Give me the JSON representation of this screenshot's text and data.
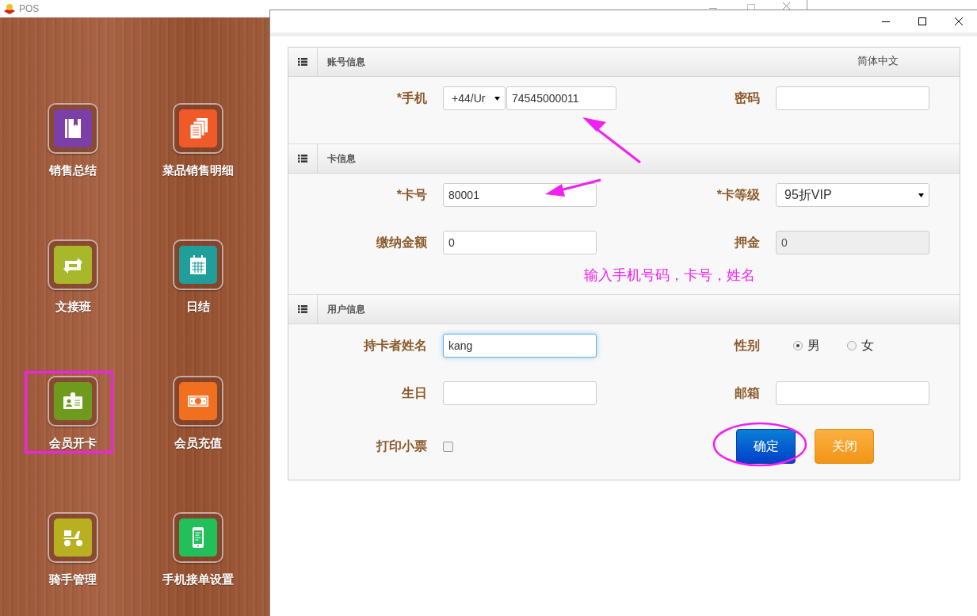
{
  "back_window": {
    "title": "POS"
  },
  "tiles": [
    {
      "label": "销售总结",
      "kind": "book",
      "color": "#7b3fa6",
      "highlighted": false
    },
    {
      "label": "菜品销售明细",
      "kind": "documents",
      "color": "#f05a28",
      "highlighted": false
    },
    {
      "label": "文接班",
      "kind": "swap",
      "color": "#a8b82a",
      "highlighted": false
    },
    {
      "label": "日结",
      "kind": "calendar",
      "color": "#1f9e9a",
      "highlighted": false
    },
    {
      "label": "会员开卡",
      "kind": "badge",
      "color": "#6e9a1e",
      "highlighted": true
    },
    {
      "label": "会员充值",
      "kind": "money",
      "color": "#f07020",
      "highlighted": false
    },
    {
      "label": "骑手管理",
      "kind": "scooter",
      "color": "#b8b020",
      "highlighted": false
    },
    {
      "label": "手机接单设置",
      "kind": "phone",
      "color": "#22c05a",
      "highlighted": false
    }
  ],
  "dialog": {
    "sections": [
      {
        "title": "账号信息",
        "language": "简体中文",
        "fields": [
          {
            "label": "*手机",
            "kind": "phone",
            "country": "+44/Ur",
            "value": "74545000011"
          },
          {
            "label": "密码",
            "kind": "text",
            "disabled": false,
            "focused": false
          }
        ]
      },
      {
        "title": "卡信息",
        "fields": [
          {
            "label": "*卡号",
            "kind": "text",
            "value": "80001",
            "disabled": false,
            "focused": false
          },
          {
            "label": "*卡等级",
            "kind": "select",
            "value": "95折VIP"
          },
          {
            "label": "缴纳金额",
            "kind": "text",
            "value": "0",
            "disabled": false,
            "focused": false
          },
          {
            "label": "押金",
            "kind": "text",
            "value": "0",
            "disabled": true,
            "focused": false
          }
        ],
        "note": "输入手机号码，卡号，姓名"
      },
      {
        "title": "用户信息",
        "fields": [
          {
            "label": "持卡者姓名",
            "kind": "text",
            "value": "kang",
            "disabled": false,
            "focused": true
          },
          {
            "label": "性别",
            "kind": "radio",
            "options": [
              {
                "label": "男",
                "selected": true
              },
              {
                "label": "女",
                "selected": false
              }
            ]
          },
          {
            "label": "生日",
            "kind": "text",
            "disabled": false,
            "focused": false
          },
          {
            "label": "邮箱",
            "kind": "text",
            "disabled": false,
            "focused": false
          },
          {
            "label": "打印小票",
            "kind": "checkbox",
            "checked": false
          }
        ]
      }
    ],
    "buttons": [
      {
        "label": "确定",
        "kind": "primary",
        "circled": true
      },
      {
        "label": "关闭",
        "kind": "warning",
        "circled": false
      }
    ]
  }
}
